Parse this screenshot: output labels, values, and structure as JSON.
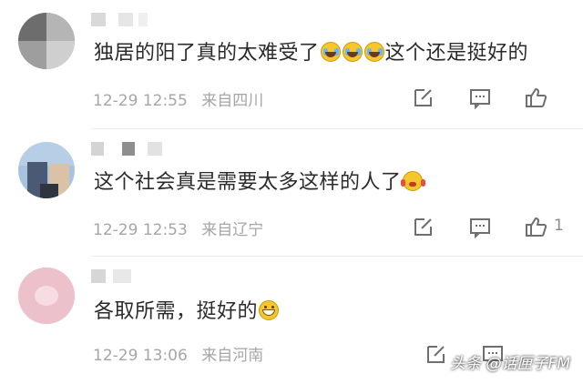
{
  "comments": [
    {
      "text": "独居的阳了真的太难受了",
      "emoji": [
        "crying-laughing-emoji",
        "crying-laughing-emoji",
        "crying-laughing-emoji"
      ],
      "text_after": "这个还是挺好的",
      "date": "12-29",
      "time": "12:55",
      "location": "来自四川",
      "likes": ""
    },
    {
      "text": "这个社会真是需要太多这样的人了",
      "emoji": [
        "moved-emoji"
      ],
      "text_after": "",
      "date": "12-29",
      "time": "12:53",
      "location": "来自辽宁",
      "likes": "1"
    },
    {
      "text": "各取所需，挺好的",
      "emoji": [
        "grinning-emoji"
      ],
      "text_after": "",
      "date": "12-29",
      "time": "13:06",
      "location": "来自河南",
      "likes": ""
    }
  ],
  "icons": [
    "edit-icon",
    "comment-icon",
    "thumbs-up-icon"
  ],
  "watermark": "头条 @话匣子FM",
  "colors": {
    "text": "#2b2b2b",
    "meta": "#a6a6a6",
    "divider": "#ececec"
  }
}
